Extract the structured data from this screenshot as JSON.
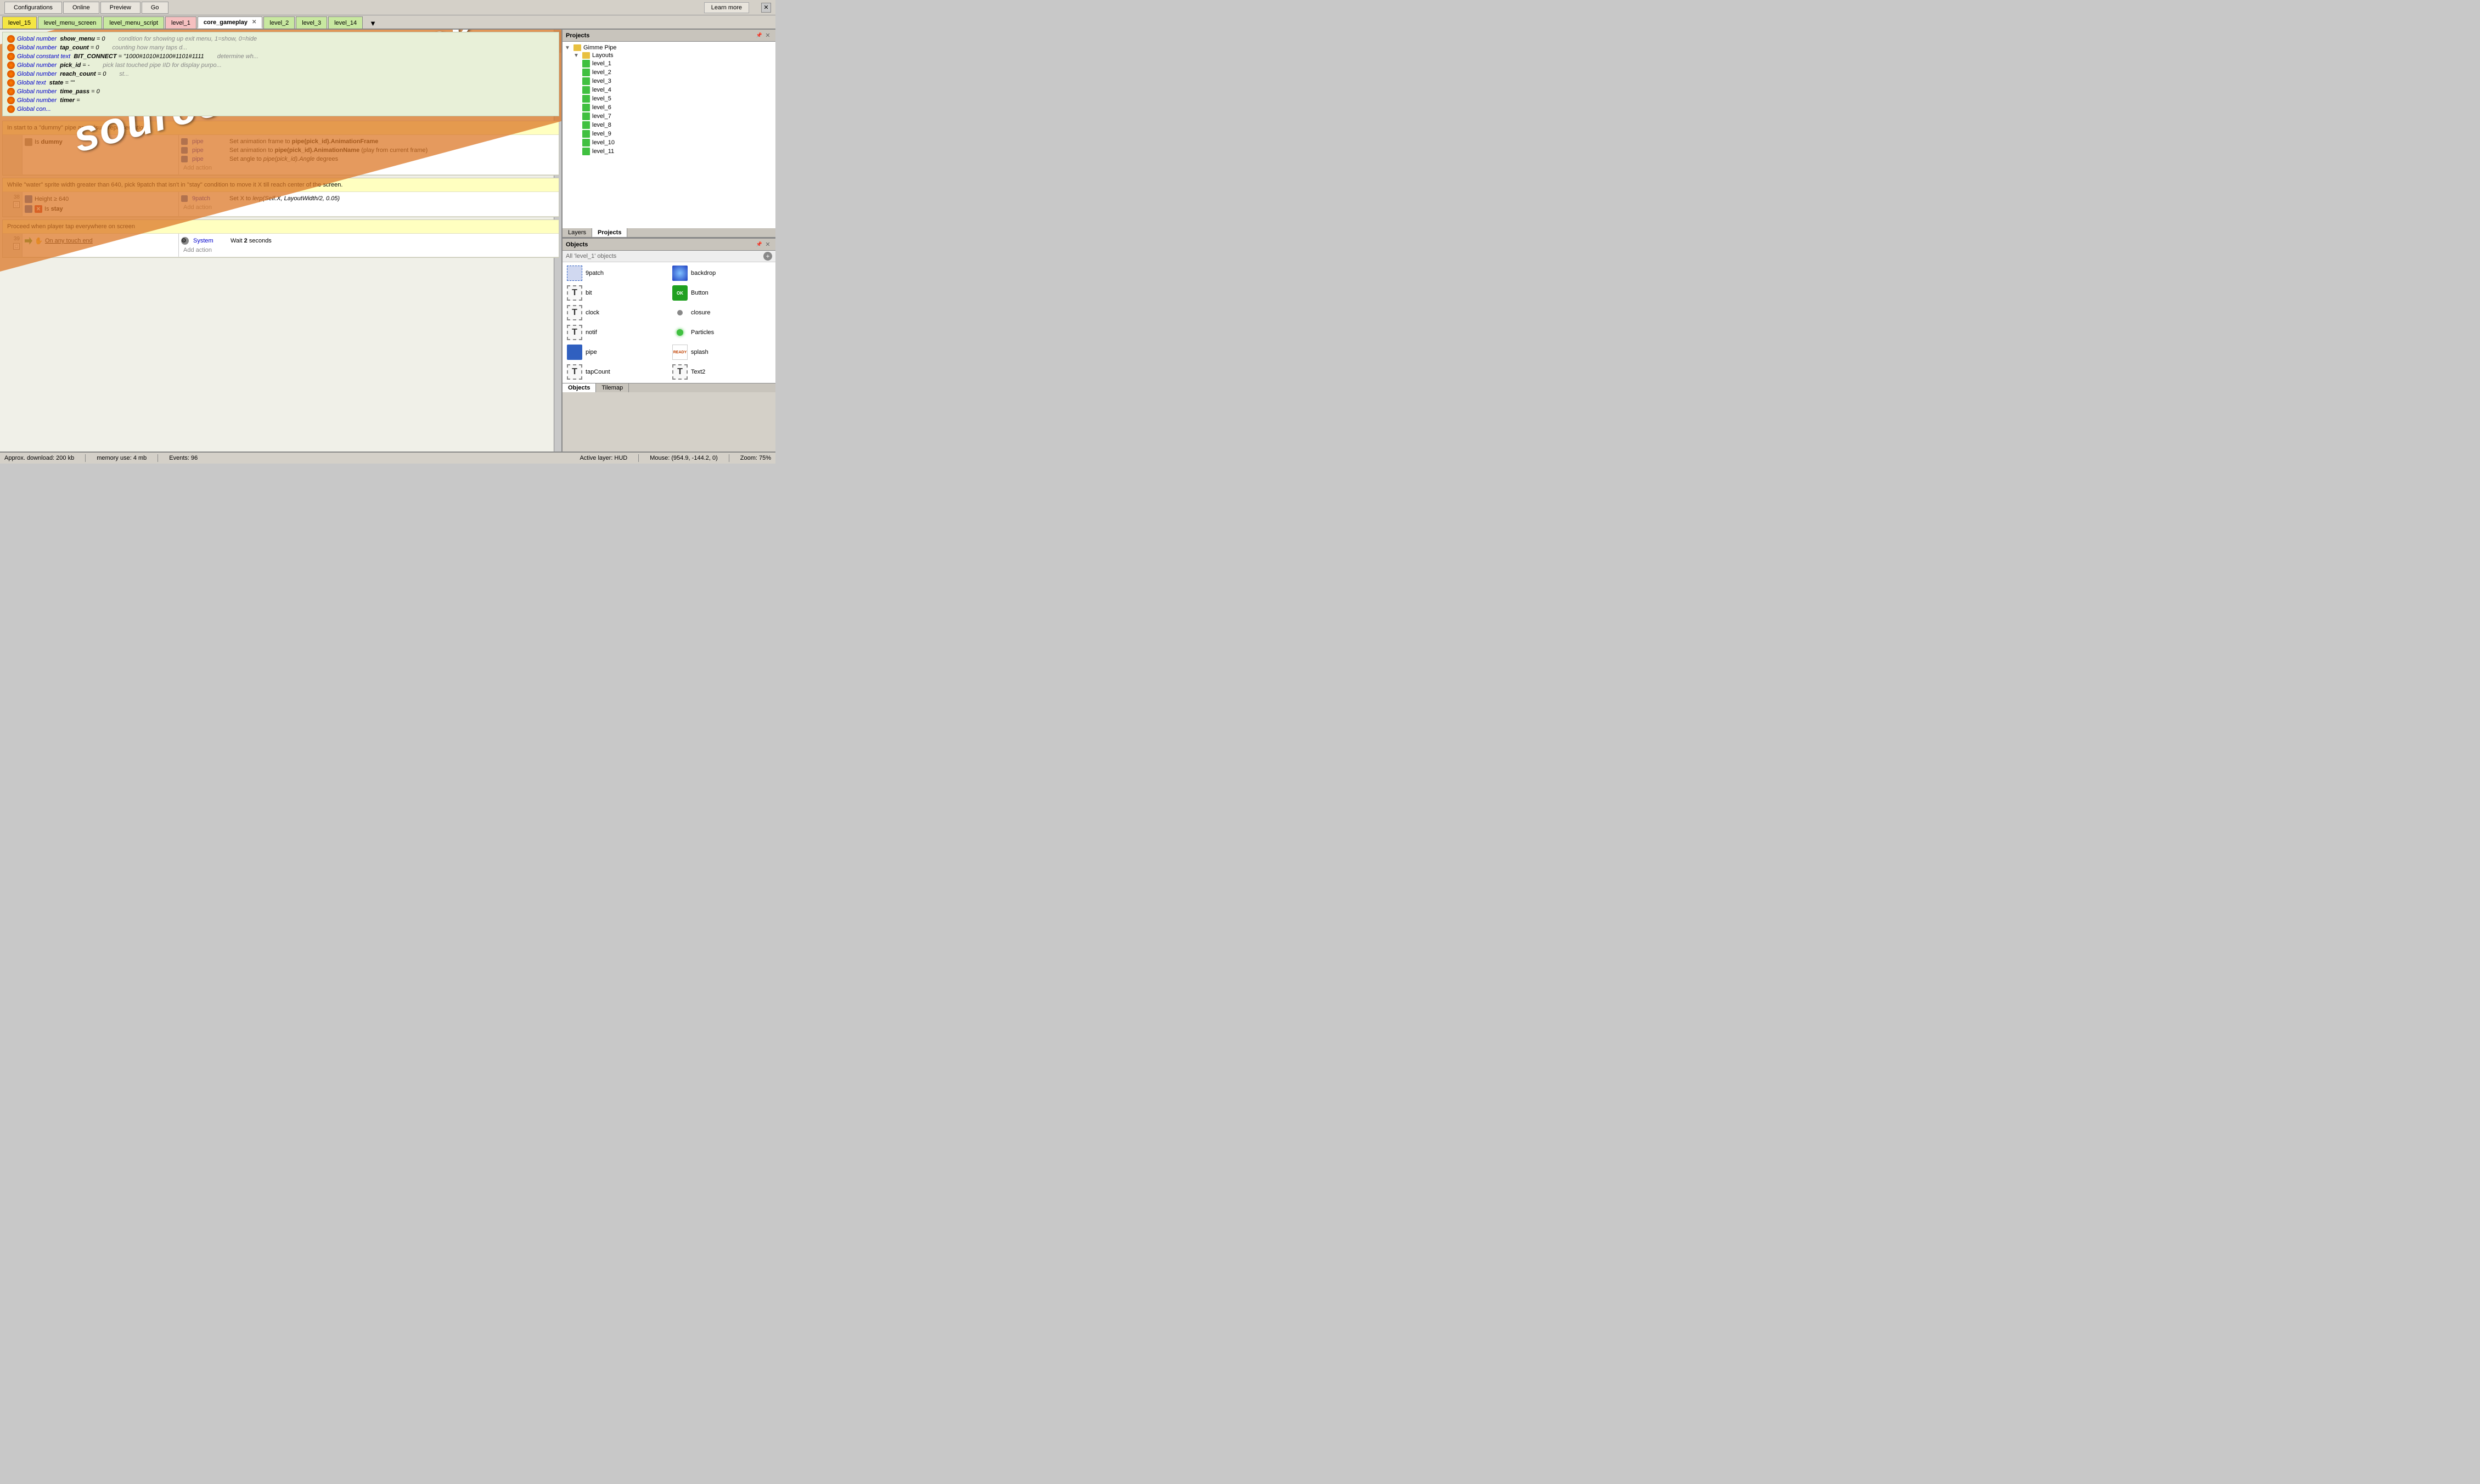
{
  "topbar": {
    "buttons": [
      "Configurations",
      "Online",
      "Preview",
      "Go"
    ]
  },
  "learnMore": {
    "label": "Learn more"
  },
  "tabs": [
    {
      "id": "level_15",
      "label": "level_15",
      "color": "yellow",
      "active": false
    },
    {
      "id": "level_menu_screen",
      "label": "level_menu_screen",
      "color": "green",
      "active": false
    },
    {
      "id": "level_menu_script",
      "label": "level_menu_script",
      "color": "green",
      "active": false
    },
    {
      "id": "level_1",
      "label": "level_1",
      "color": "pink",
      "active": false
    },
    {
      "id": "core_gameplay",
      "label": "core_gameplay",
      "color": "white",
      "active": true,
      "closeable": true
    },
    {
      "id": "level_2",
      "label": "level_2",
      "color": "green",
      "active": false
    },
    {
      "id": "level_3",
      "label": "level_3",
      "color": "green",
      "active": false
    },
    {
      "id": "level_14",
      "label": "level_14",
      "color": "green",
      "active": false
    }
  ],
  "globals": [
    {
      "type": "Global number",
      "name": "show_menu",
      "value": "= 0",
      "comment": "condition for showing up exit menu, 1=show, 0=hide"
    },
    {
      "type": "Global number",
      "name": "tap_count",
      "value": "= 0",
      "comment": "counting how many taps d..."
    },
    {
      "type": "Global constant text",
      "name": "BIT_CONNECT",
      "value": "= \"1000#1010#1100#1101#1111",
      "comment": "determine wh..."
    },
    {
      "type": "Global number",
      "name": "pick_id",
      "value": "= -",
      "comment": "pick last touched pipe IID for display purpo..."
    },
    {
      "type": "Global number",
      "name": "reach_count",
      "value": "= 0",
      "comment": "st..."
    },
    {
      "type": "Global text",
      "name": "state",
      "value": "= \"\""
    },
    {
      "type": "Global number",
      "name": "time_pass",
      "value": "= 0"
    },
    {
      "type": "Global number",
      "name": "timer",
      "value": "="
    },
    {
      "type": "Global con...",
      "name": "",
      "value": ""
    }
  ],
  "events": {
    "block1": {
      "header": "In start to a \"dummy\" pipe as a visual representation.",
      "conditions": [
        {
          "label": "Is dummy"
        }
      ],
      "actions": [
        {
          "obj": "pipe",
          "text": "Set animation frame to pipe(pick_id).AnimationFrame"
        },
        {
          "obj": "pipe",
          "text": "Set animation to pipe(pick_id).AnimationName (play from current frame)"
        },
        {
          "obj": "pipe",
          "text": "Set angle to pipe(pick_id).Angle degrees"
        },
        {
          "add": "Add action"
        }
      ]
    },
    "block2": {
      "rowNum": "38",
      "header": "While \"water\" sprite width greater than 640, pick 9patch that isn't in \"stay\" condition to move it X till reach center of the screen.",
      "conditions": [
        {
          "icon": "blue",
          "label": "Height ≥ 640"
        },
        {
          "icon": "red-x",
          "label": "Is stay"
        }
      ],
      "actions": [
        {
          "obj": "9patch",
          "text": "Set X to lerp(Self.X, LayoutWidth/2, 0.05)"
        },
        {
          "add": "Add action"
        }
      ]
    },
    "block3": {
      "rowNum": "39",
      "header": "Proceed when player tap everywhere on screen",
      "trigger": "On any touch end",
      "triggerSystem": "System",
      "actions": [
        {
          "text": "Wait 2 seconds"
        },
        {
          "add": "Add action"
        }
      ]
    }
  },
  "projects": {
    "title": "Projects",
    "tree": {
      "root": "Gimme Pipe",
      "folders": [
        {
          "name": "Layouts",
          "items": [
            "level_1",
            "level_2",
            "level_3",
            "level_4",
            "level_5",
            "level_6",
            "level_7",
            "level_8",
            "level_9",
            "level_10",
            "level_11"
          ]
        }
      ]
    }
  },
  "layers": {
    "tabs": [
      "Layers",
      "Projects"
    ]
  },
  "objects": {
    "title": "Objects",
    "subtitle": "All 'level_1' objects",
    "items": [
      {
        "name": "9patch",
        "type": "square-dashed",
        "color": "#3060c0"
      },
      {
        "name": "backdrop",
        "type": "glow",
        "color": "#4080ff"
      },
      {
        "name": "bit",
        "type": "text-dashed",
        "label": "T"
      },
      {
        "name": "Button",
        "type": "ok-button",
        "color": "#20a020"
      },
      {
        "name": "clock",
        "type": "text-dashed",
        "label": "T"
      },
      {
        "name": "closure",
        "type": "dot",
        "color": "#888"
      },
      {
        "name": "notif",
        "type": "text-dashed",
        "label": "T"
      },
      {
        "name": "Particles",
        "type": "dot-green",
        "color": "#40c040"
      },
      {
        "name": "pipe",
        "type": "rect-blue",
        "color": "#3060c0"
      },
      {
        "name": "splash",
        "type": "ready-label"
      },
      {
        "name": "tapCount",
        "type": "text-dashed",
        "label": "T"
      },
      {
        "name": "Text2",
        "type": "text-dashed-bold",
        "label": "T"
      }
    ]
  },
  "bottomTabs": [
    "Objects",
    "Tilemap"
  ],
  "statusBar": {
    "download": "Approx. download: 200 kb",
    "memory": "memory use: 4 mb",
    "events": "Events: 96",
    "activeLayer": "Active layer: HUD",
    "mouse": "Mouse: (954.9, -144.2, 0)",
    "zoom": "Zoom: 75%"
  },
  "sneakPeek": {
    "text": "source sneak-peek"
  }
}
